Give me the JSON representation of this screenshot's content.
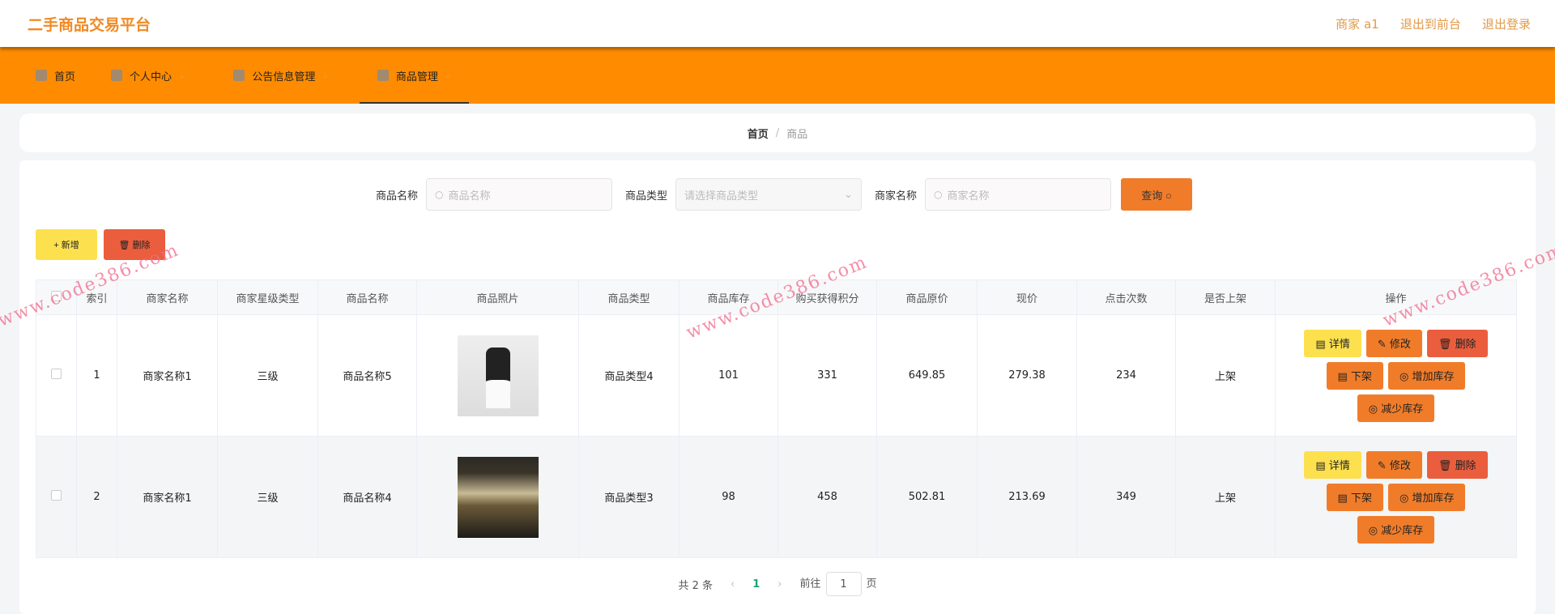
{
  "header": {
    "title": "二手商品交易平台",
    "user": "商家 a1",
    "to_front": "退出到前台",
    "logout": "退出登录"
  },
  "nav": [
    {
      "label": "首页"
    },
    {
      "label": "个人中心"
    },
    {
      "label": "公告信息管理"
    },
    {
      "label": "商品管理"
    }
  ],
  "breadcrumb": {
    "home": "首页",
    "sep": "/",
    "current": "商品"
  },
  "search": {
    "name_label": "商品名称",
    "name_placeholder": "商品名称",
    "type_label": "商品类型",
    "type_placeholder": "请选择商品类型",
    "merchant_label": "商家名称",
    "merchant_placeholder": "商家名称",
    "query": "查询"
  },
  "actions": {
    "add": "+ 新增",
    "delete": "🗑 删除"
  },
  "table": {
    "headers": [
      "索引",
      "商家名称",
      "商家星级类型",
      "商品名称",
      "商品照片",
      "商品类型",
      "商品库存",
      "购买获得积分",
      "商品原价",
      "现价",
      "点击次数",
      "是否上架",
      "操作"
    ],
    "rows": [
      {
        "index": "1",
        "merchant": "商家名称1",
        "level": "三级",
        "name": "商品名称5",
        "type": "商品类型4",
        "stock": "101",
        "points": "331",
        "orig": "649.85",
        "price": "279.38",
        "clicks": "234",
        "listed": "上架"
      },
      {
        "index": "2",
        "merchant": "商家名称1",
        "level": "三级",
        "name": "商品名称4",
        "type": "商品类型3",
        "stock": "98",
        "points": "458",
        "orig": "502.81",
        "price": "213.69",
        "clicks": "349",
        "listed": "上架"
      }
    ],
    "ops": {
      "detail": "详情",
      "edit": "修改",
      "delete": "删除",
      "unlist": "下架",
      "add_stock": "增加库存",
      "reduce_stock": "减少库存"
    }
  },
  "pagination": {
    "total": "共 2 条",
    "current": "1",
    "goto": "前往",
    "page_value": "1",
    "page_suffix": "页"
  },
  "watermark": "www.code386.com"
}
